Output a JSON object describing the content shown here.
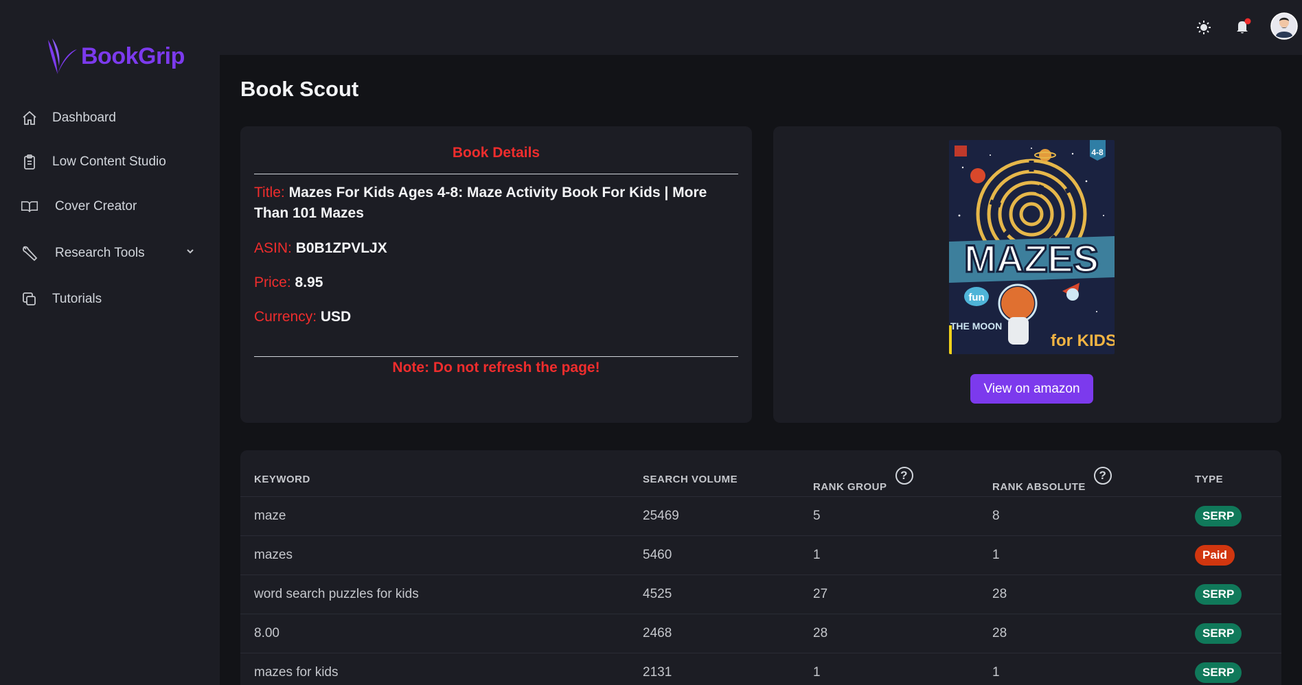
{
  "app": {
    "name": "BookGrip",
    "brand_color": "#7c3aed",
    "accent_red": "#ef2d2d"
  },
  "sidebar": {
    "items": [
      {
        "label": "Dashboard",
        "icon": "home-icon"
      },
      {
        "label": "Low Content Studio",
        "icon": "clipboard-icon"
      },
      {
        "label": "Cover Creator",
        "icon": "book-open-icon"
      },
      {
        "label": "Research Tools",
        "icon": "wrench-icon",
        "has_submenu": true
      },
      {
        "label": "Tutorials",
        "icon": "copy-icon"
      }
    ]
  },
  "topbar": {
    "icons": [
      "sun-icon",
      "bell-icon",
      "avatar"
    ],
    "notification_dot_color": "#ef2d2d"
  },
  "page": {
    "title": "Book Scout"
  },
  "book_details": {
    "heading": "Book Details",
    "title_label": "Title:",
    "title_value": "Mazes For Kids Ages 4-8: Maze Activity Book For Kids | More Than 101 Mazes",
    "asin_label": "ASIN:",
    "asin_value": "B0B1ZPVLJX",
    "price_label": "Price:",
    "price_value": "8.95",
    "currency_label": "Currency:",
    "currency_value": "USD",
    "note": "Note: Do not refresh the page!"
  },
  "cover": {
    "title_text": "MAZES",
    "subtitle_a": "fun",
    "subtitle_b": "TO THE MOON",
    "subtitle_c": "for KIDS",
    "age": "4-8",
    "button_label": "View on amazon"
  },
  "keywords_table": {
    "columns": [
      "KEYWORD",
      "SEARCH VOLUME",
      "RANK GROUP",
      "RANK ABSOLUTE",
      "TYPE"
    ],
    "help_glyph": "?",
    "rows": [
      {
        "keyword": "maze",
        "volume": "25469",
        "rank_group": "5",
        "rank_absolute": "8",
        "type": "SERP"
      },
      {
        "keyword": "mazes",
        "volume": "5460",
        "rank_group": "1",
        "rank_absolute": "1",
        "type": "Paid"
      },
      {
        "keyword": "word search puzzles for kids",
        "volume": "4525",
        "rank_group": "27",
        "rank_absolute": "28",
        "type": "SERP"
      },
      {
        "keyword": "8.00",
        "volume": "2468",
        "rank_group": "28",
        "rank_absolute": "28",
        "type": "SERP"
      },
      {
        "keyword": "mazes for kids",
        "volume": "2131",
        "rank_group": "1",
        "rank_absolute": "1",
        "type": "SERP"
      }
    ]
  }
}
